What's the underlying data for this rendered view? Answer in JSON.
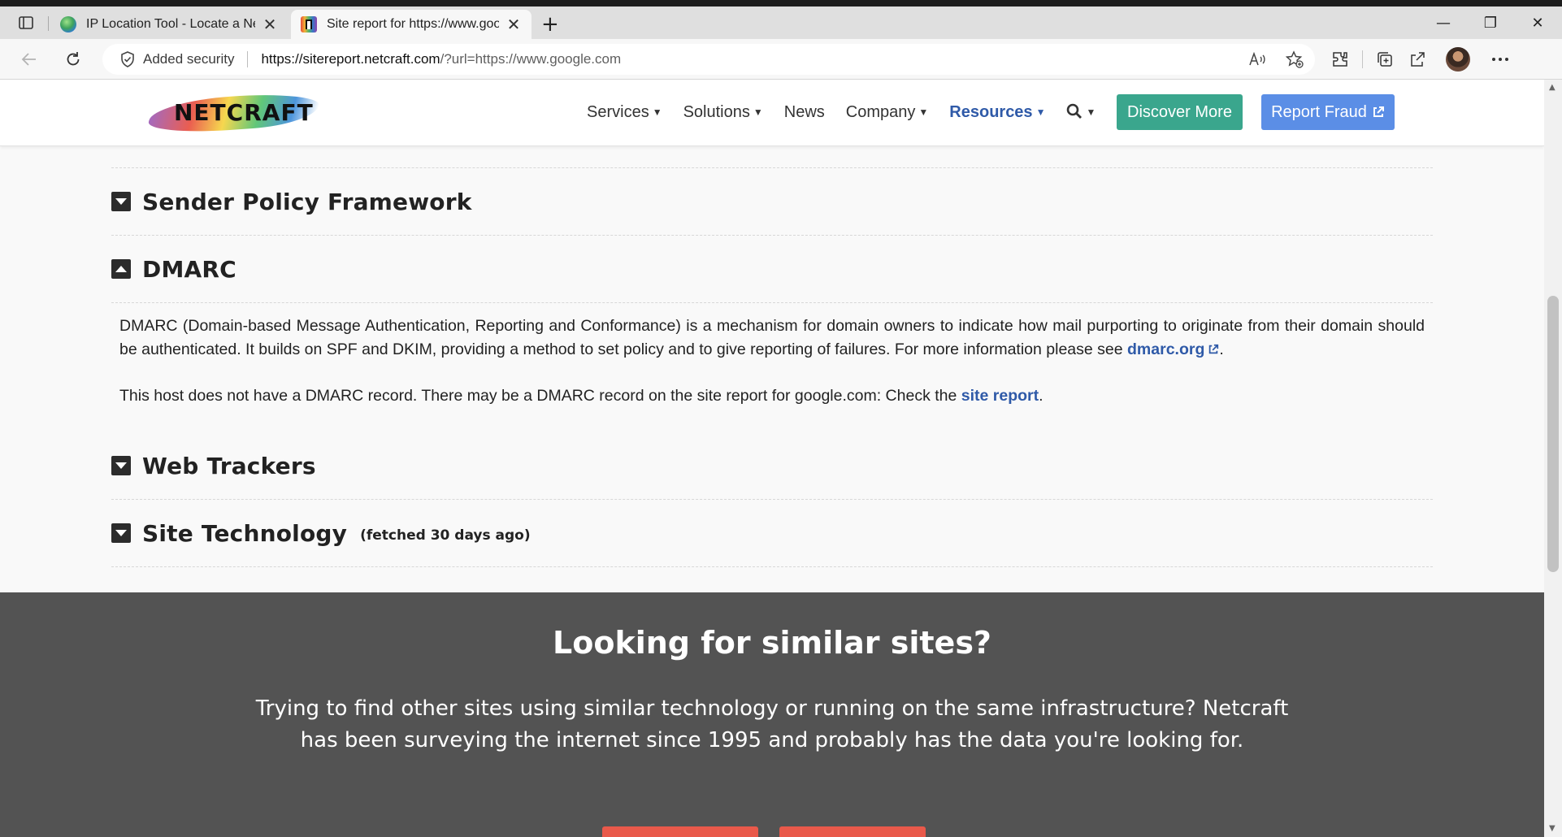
{
  "browser": {
    "tabs": [
      {
        "title": "IP Location Tool - Locate a Netw",
        "close": "✕"
      },
      {
        "title": "Site report for https://www.goog",
        "close": "✕"
      }
    ],
    "new_tab": "+",
    "window_controls": {
      "minimize": "—",
      "restore": "❐",
      "close": "✕"
    },
    "security_label": "Added security",
    "url_host": "https://sitereport.netcraft.com",
    "url_path": "/?url=https://www.google.com",
    "icons": [
      "back-icon",
      "refresh-icon",
      "shield-icon",
      "read-aloud-icon",
      "favorites-add-icon",
      "extensions-icon",
      "collections-icon",
      "share-icon",
      "avatar",
      "more-icon"
    ]
  },
  "site_header": {
    "logo_text": "NETCRAFT",
    "nav": [
      {
        "label": "Services",
        "caret": "▼"
      },
      {
        "label": "Solutions",
        "caret": "▼"
      },
      {
        "label": "News",
        "caret": ""
      },
      {
        "label": "Company",
        "caret": "▼"
      },
      {
        "label": "Resources",
        "caret": "▼"
      }
    ],
    "search_icon": "🔍︎",
    "search_caret": "▼",
    "discover_label": "Discover More",
    "report_label": "Report Fraud",
    "external_icon": "⧉"
  },
  "sections": {
    "spf": {
      "title": "Sender Policy Framework",
      "state": "collapsed"
    },
    "dmarc": {
      "title": "DMARC",
      "state": "expanded",
      "para1_text": "DMARC (Domain-based Message Authentication, Reporting and Conformance) is a mechanism for domain owners to indicate how mail purporting to originate from their domain should be authenticated. It builds on SPF and DKIM, providing a method to set policy and to give reporting of failures. For more information please see ",
      "para1_link": "dmarc.org",
      "para1_end": ".",
      "para2_text": "This host does not have a DMARC record. There may be a DMARC record on the site report for google.com: Check the ",
      "para2_link": "site report",
      "para2_end": "."
    },
    "trackers": {
      "title": "Web Trackers",
      "state": "collapsed"
    },
    "tech": {
      "title": "Site Technology",
      "subtitle": "(fetched 30 days ago)",
      "state": "collapsed"
    }
  },
  "cta": {
    "title": "Looking for similar sites?",
    "text": "Trying to find other sites using similar technology or running on the same infrastructure? Netcraft has been surveying the internet since 1995 and probably has the data you're looking for."
  },
  "colors": {
    "accent_blue": "#2f5aa8",
    "discover_green": "#3aa68d",
    "report_blue": "#5b8ee6",
    "cta_bg": "#535353",
    "cta_button": "#e9594a"
  }
}
